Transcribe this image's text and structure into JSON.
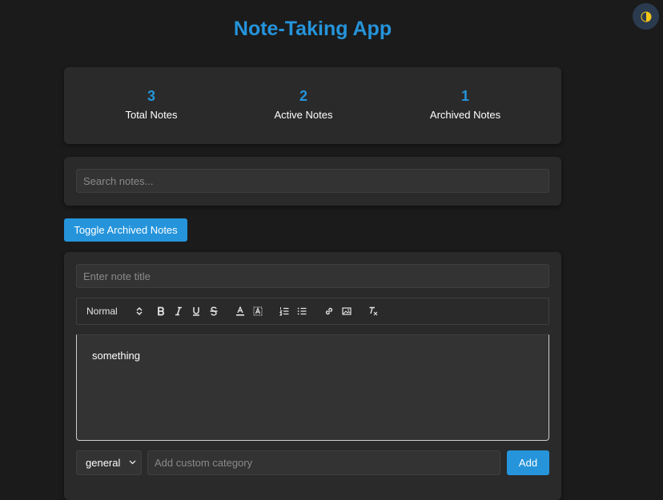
{
  "app": {
    "title": "Note-Taking App",
    "accent_color": "#2594db",
    "background_color": "#1b1b1b",
    "panel_color": "#2a2a2a"
  },
  "theme_toggle": {
    "icon": "half-circle-contrast-icon"
  },
  "stats": [
    {
      "value": "3",
      "label": "Total Notes"
    },
    {
      "value": "2",
      "label": "Active Notes"
    },
    {
      "value": "1",
      "label": "Archived Notes"
    }
  ],
  "search": {
    "placeholder": "Search notes...",
    "value": ""
  },
  "toggle_archived": {
    "label": "Toggle Archived Notes"
  },
  "note_form": {
    "title_placeholder": "Enter note title",
    "title_value": "",
    "toolbar": {
      "header_select": "Normal",
      "buttons": [
        "bold-icon",
        "italic-icon",
        "underline-icon",
        "strikethrough-icon",
        "text-color-icon",
        "background-color-icon",
        "ordered-list-icon",
        "bullet-list-icon",
        "link-icon",
        "image-icon",
        "clear-formatting-icon"
      ]
    },
    "content": "something",
    "category_select": "general",
    "custom_category_placeholder": "Add custom category",
    "add_label": "Add"
  }
}
